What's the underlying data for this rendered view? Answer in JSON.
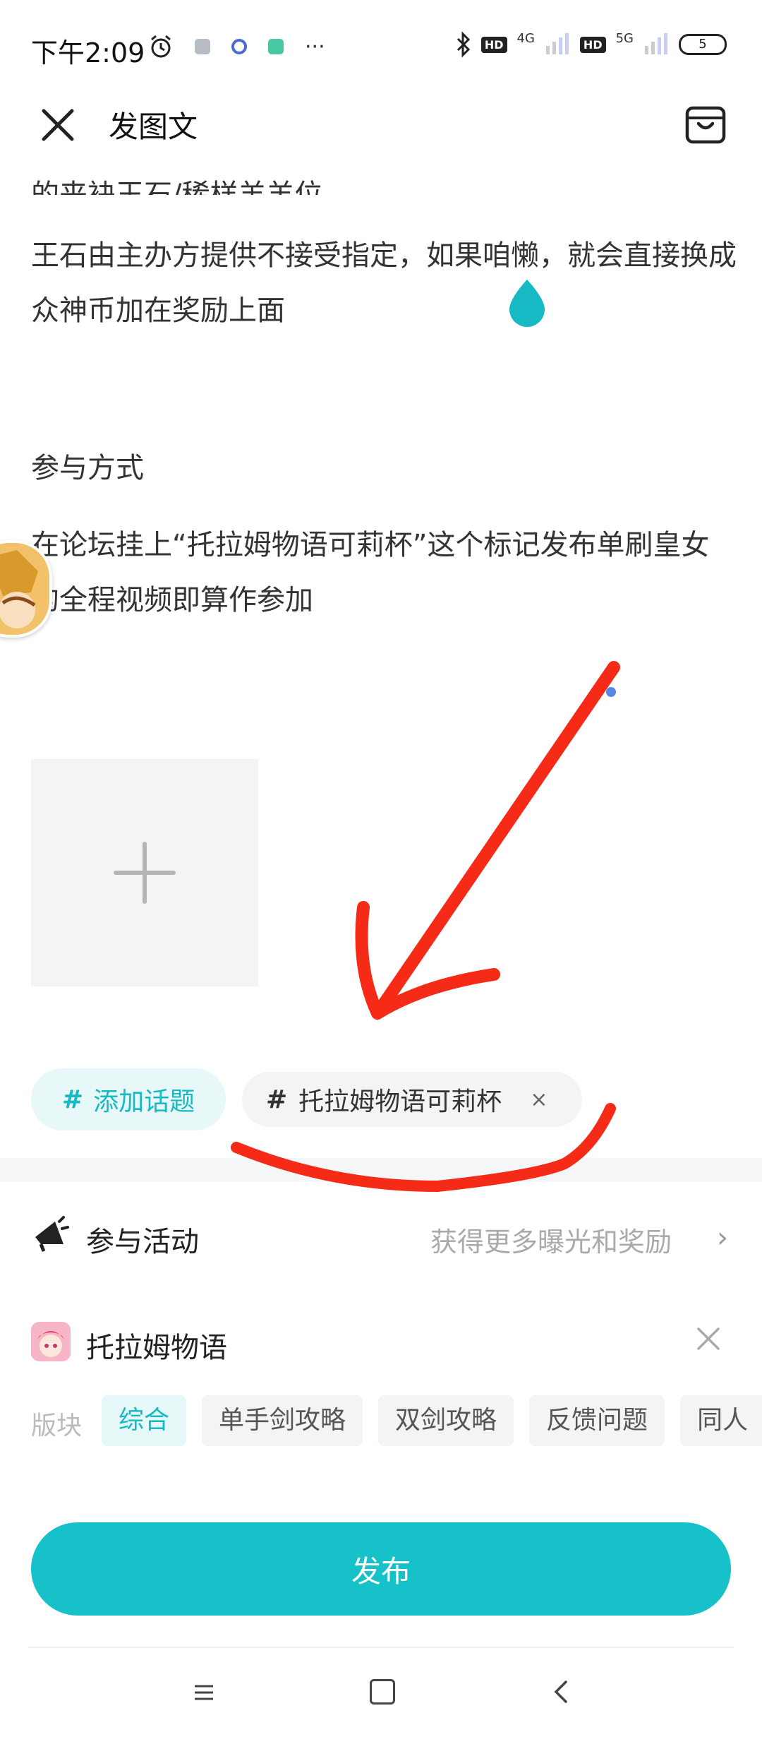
{
  "status_bar": {
    "time": "下午2:09",
    "more": "···",
    "net1": "4G",
    "net2": "5G",
    "hd": "HD",
    "battery": "5"
  },
  "header": {
    "title": "发图文"
  },
  "content": {
    "cut_line": "的来袂王石/稀样羊羊位",
    "para1": "王石由主办方提供不接受指定，如果咱懒，就会直接换成众神币加在奖励上面",
    "para2": "参与方式",
    "para3": "在论坛挂上“托拉姆物语可莉杯”这个标记发布单刷皇女的全程视频即算作参加"
  },
  "topics": {
    "add_label": "添加话题",
    "hash": "#",
    "selected": "托拉姆物语可莉杯",
    "remove": "×"
  },
  "activity": {
    "label": "参与活动",
    "hint": "获得更多曝光和奖励",
    "chevron": "›"
  },
  "game": {
    "name": "托拉姆物语"
  },
  "section": {
    "label": "版块",
    "chips": [
      "综合",
      "单手剑攻略",
      "双剑攻略",
      "反馈问题",
      "同人"
    ]
  },
  "publish": {
    "label": "发布"
  },
  "colors": {
    "accent": "#17c1c9",
    "annotation": "#f52a17"
  },
  "icons": [
    "alarm-icon",
    "bluetooth-icon",
    "close-icon",
    "bag-icon",
    "megaphone-icon",
    "plus-icon",
    "menu-icon",
    "home-icon",
    "back-icon"
  ]
}
